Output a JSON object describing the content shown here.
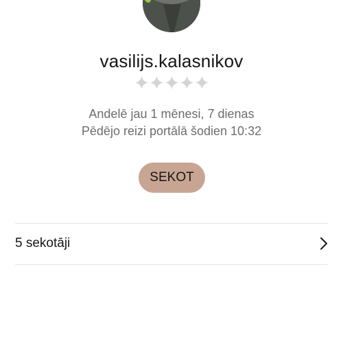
{
  "profile": {
    "username": "vasilijs.kalasnikov",
    "rating": 0,
    "rating_max": 5,
    "member_since": "Andelē jau 1 mēnesi, 7 dienas",
    "last_seen": "Pēdējo reizi portālā šodien 10:32"
  },
  "actions": {
    "follow_label": "SEKOT"
  },
  "followers": {
    "label": "5 sekotāji"
  },
  "icons": {
    "rating": "star-icon",
    "followers_arrow": "chevron-right-icon"
  },
  "colors": {
    "follow_button": "#c8a592",
    "star_empty": "#d4d4d4",
    "secondary_text": "#6d6d6d"
  }
}
